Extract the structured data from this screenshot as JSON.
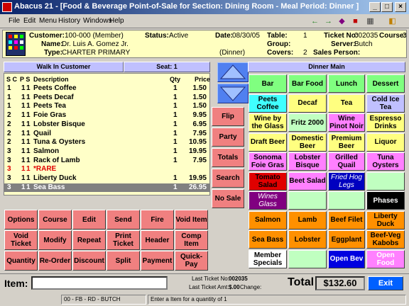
{
  "window": {
    "title": "Abacus 21 - [Food & Beverage Point-of-Sale for Section: Dining Room - Meal Period: Dinner ]",
    "buttons": [
      "_",
      "□",
      "×"
    ]
  },
  "menu": [
    "File",
    "Edit",
    "Menu",
    "History",
    "Windows",
    "Help"
  ],
  "toolbar_icons": [
    "back-arrow-icon",
    "forward-arrow-icon",
    "gem-icon",
    "book-icon",
    "calculator-icon",
    "exit-door-icon"
  ],
  "info": {
    "customer_label": "Customer:",
    "customer": "100-000 (Member)",
    "name_label": "Name:",
    "name": "Dr. Luis A. Gomez Jr.",
    "type_label": "Type:",
    "type": "CHARTER PRIMARY",
    "status_label": "Status:",
    "status": "Active",
    "date_label": "Date:",
    "date": "08/30/05",
    "period": "(Dinner)",
    "table_label": "Table:",
    "table": "1",
    "group_label": "Group:",
    "group": "",
    "covers_label": "Covers:",
    "covers": "2",
    "ticket_label": "Ticket No:",
    "ticket": "002035",
    "course_label": "Course:",
    "course": "3",
    "server_label": "Server:",
    "server": "Butch",
    "salesperson_label": "Sales Person:",
    "salesperson": ""
  },
  "order": {
    "walkin": "Walk In  Customer",
    "seat": "Seat: 1",
    "headers": {
      "sc": "S C",
      "ps": "P S",
      "desc": "Description",
      "qty": "Qty",
      "price": "Price"
    },
    "rows": [
      {
        "c": "1",
        "p": "1",
        "s": "1",
        "desc": "Peets Coffee",
        "qty": "1",
        "price": "1.50",
        "style": ""
      },
      {
        "c": "1",
        "p": "1",
        "s": "1",
        "desc": "Peets Decaf",
        "qty": "1",
        "price": "1.50",
        "style": ""
      },
      {
        "c": "1",
        "p": "1",
        "s": "1",
        "desc": "Peets Tea",
        "qty": "1",
        "price": "1.50",
        "style": ""
      },
      {
        "c": "2",
        "p": "1",
        "s": "1",
        "desc": "Foie Gras",
        "qty": "1",
        "price": "9.95",
        "style": ""
      },
      {
        "c": "2",
        "p": "1",
        "s": "1",
        "desc": "Lobster Bisque",
        "qty": "1",
        "price": "6.95",
        "style": ""
      },
      {
        "c": "2",
        "p": "1",
        "s": "1",
        "desc": "Quail",
        "qty": "1",
        "price": "7.95",
        "style": ""
      },
      {
        "c": "2",
        "p": "1",
        "s": "1",
        "desc": "Tuna & Oysters",
        "qty": "1",
        "price": "10.95",
        "style": ""
      },
      {
        "c": "3",
        "p": "1",
        "s": "1",
        "desc": "Salmon",
        "qty": "1",
        "price": "19.95",
        "style": ""
      },
      {
        "c": "3",
        "p": "1",
        "s": "1",
        "desc": "Rack of Lamb",
        "qty": "1",
        "price": "7.95",
        "style": ""
      },
      {
        "c": "3",
        "p": "1",
        "s": "1",
        "desc": "  *RARE",
        "qty": "",
        "price": "",
        "style": "red"
      },
      {
        "c": "3",
        "p": "1",
        "s": "1",
        "desc": "Liberty Duck",
        "qty": "1",
        "price": "19.95",
        "style": ""
      },
      {
        "c": "3",
        "p": "1",
        "s": "1",
        "desc": "Sea Bass",
        "qty": "1",
        "price": "26.95",
        "style": "sel"
      }
    ]
  },
  "side_buttons": [
    "Flip",
    "Party",
    "Totals",
    "Search",
    "No Sale"
  ],
  "action_buttons": [
    [
      "Options",
      "Course",
      "Edit",
      "Send",
      "Fire",
      "Void Item"
    ],
    [
      "Void Ticket",
      "Modify",
      "Repeat",
      "Print Ticket",
      "Header",
      "Comp Item"
    ],
    [
      "Quantity",
      "Re-Order",
      "Discount",
      "Split",
      "Payment",
      "Quick-Pay"
    ]
  ],
  "menu_panel": {
    "title": "Dinner Main",
    "items": [
      [
        {
          "label": "Bar",
          "bg": "#80ff80",
          "fg": "#000"
        },
        {
          "label": "Bar Food",
          "bg": "#80ff80",
          "fg": "#000"
        },
        {
          "label": "Lunch",
          "bg": "#80ff80",
          "fg": "#000"
        },
        {
          "label": "Dessert",
          "bg": "#80ff80",
          "fg": "#000"
        }
      ],
      [
        {
          "label": "Peets Coffee",
          "bg": "#40ffff",
          "fg": "#000"
        },
        {
          "label": "Decaf",
          "bg": "#ffff80",
          "fg": "#000"
        },
        {
          "label": "Tea",
          "bg": "#ffff80",
          "fg": "#000"
        },
        {
          "label": "Cold Ice Tea",
          "bg": "#c0c0ff",
          "fg": "#000"
        }
      ],
      [
        {
          "label": "Wine by the Glass",
          "bg": "#ffff80",
          "fg": "#000"
        },
        {
          "label": "Fritz 2000",
          "bg": "#c0ffc0",
          "fg": "#000"
        },
        {
          "label": "Wine Pinot Noir",
          "bg": "#ff80ff",
          "fg": "#000"
        },
        {
          "label": "Espresso Drinks",
          "bg": "#ffff80",
          "fg": "#000"
        }
      ],
      [
        {
          "label": "Draft Beer",
          "bg": "#ffff80",
          "fg": "#000"
        },
        {
          "label": "Domestic Beer",
          "bg": "#ffff80",
          "fg": "#000"
        },
        {
          "label": "Premium Beer",
          "bg": "#ffff80",
          "fg": "#000"
        },
        {
          "label": "Liquor",
          "bg": "#ffff80",
          "fg": "#000"
        }
      ],
      [
        {
          "label": "Sonoma Foie Gras",
          "bg": "#ff80ff",
          "fg": "#000"
        },
        {
          "label": "Lobster Bisque",
          "bg": "#ff80ff",
          "fg": "#000"
        },
        {
          "label": "Grilled Quail",
          "bg": "#ff80ff",
          "fg": "#000"
        },
        {
          "label": "Tuna Oysters",
          "bg": "#ff80ff",
          "fg": "#000"
        }
      ],
      [
        {
          "label": "Tomato Salad",
          "bg": "#e00000",
          "fg": "#000"
        },
        {
          "label": "Beet Salad",
          "bg": "#ff80ff",
          "fg": "#000"
        },
        {
          "label": "Fried Hog Legs",
          "bg": "#0000c0",
          "fg": "#ffffff"
        },
        {
          "label": "",
          "bg": "#c0ffc0",
          "fg": "#000"
        }
      ],
      [
        {
          "label": "Wines Glass",
          "bg": "#800080",
          "fg": "#ffffff"
        },
        {
          "label": "",
          "bg": "#c0ffc0",
          "fg": "#000"
        },
        {
          "label": "",
          "bg": "#c0ffc0",
          "fg": "#000"
        },
        {
          "label": "Phases",
          "bg": "#000000",
          "fg": "#ffffff"
        }
      ],
      [
        {
          "label": "Salmon",
          "bg": "#ff9000",
          "fg": "#000"
        },
        {
          "label": "Lamb",
          "bg": "#ff9000",
          "fg": "#000"
        },
        {
          "label": "Beef Filet",
          "bg": "#ff9000",
          "fg": "#000"
        },
        {
          "label": "Liberty Duck",
          "bg": "#ff9000",
          "fg": "#000"
        }
      ],
      [
        {
          "label": "Sea Bass",
          "bg": "#ff9000",
          "fg": "#000"
        },
        {
          "label": "Lobster",
          "bg": "#ff9000",
          "fg": "#000"
        },
        {
          "label": "Eggplant",
          "bg": "#ff9000",
          "fg": "#000"
        },
        {
          "label": "Beef-Veg Kabobs",
          "bg": "#ff9000",
          "fg": "#000"
        }
      ],
      [
        {
          "label": "Member Specials",
          "bg": "#ffffff",
          "fg": "#000"
        },
        {
          "label": "",
          "bg": "#c0ffc0",
          "fg": "#000"
        },
        {
          "label": "Open Bev",
          "bg": "#0000e0",
          "fg": "#ffffff"
        },
        {
          "label": "Open Food",
          "bg": "#ff80ff",
          "fg": "#ffffff"
        }
      ]
    ]
  },
  "bottom": {
    "item_label": "Item:",
    "item_value": "",
    "last_ticket_label": "Last Ticket No:",
    "last_ticket": "002035",
    "last_amt_label": "Last Ticket Amt:",
    "last_amt": "$.00",
    "change_label": "Change:",
    "total_label": "Total",
    "total": "$132.60",
    "exit": "Exit"
  },
  "status": [
    "00 - FB - RD - BUTCH",
    "Enter a Item for a quantity of 1"
  ]
}
